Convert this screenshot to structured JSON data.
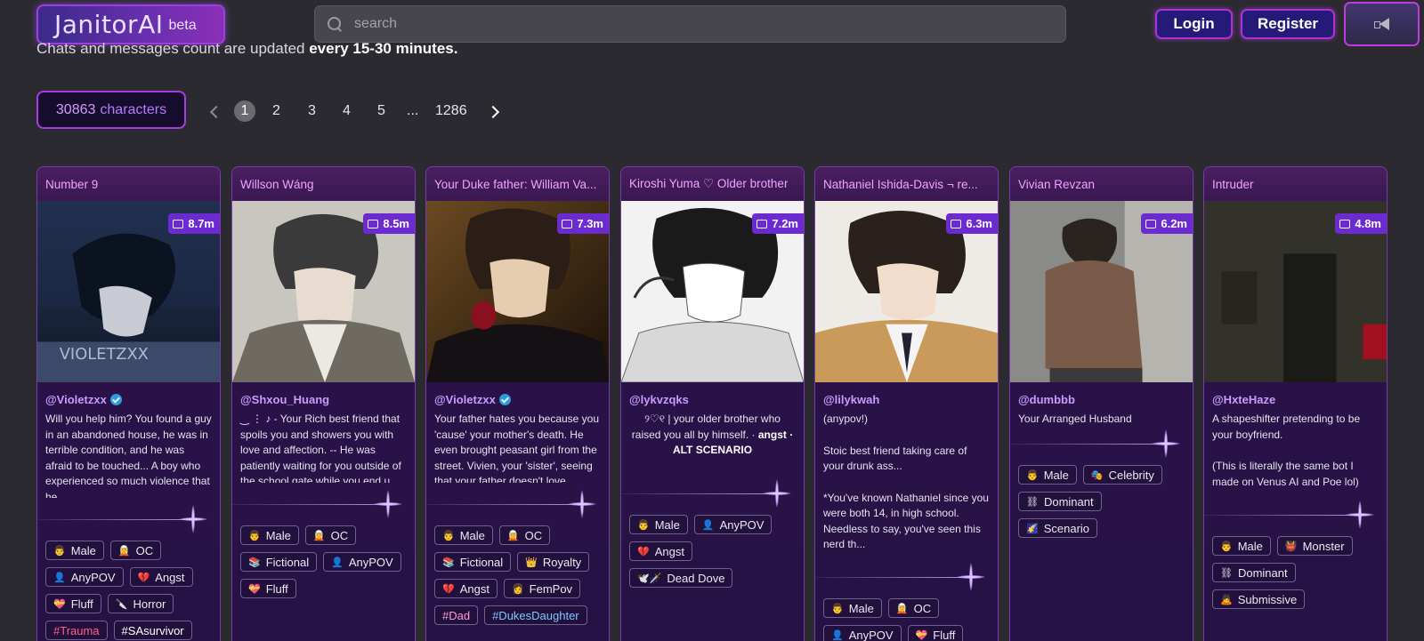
{
  "header": {
    "logo": "JanitorAI",
    "logo_badge": "beta",
    "search_placeholder": "search",
    "login_label": "Login",
    "register_label": "Register"
  },
  "notice": {
    "prefix": "Chats and messages count are updated",
    "bold": "every 15-30 minutes."
  },
  "count": {
    "number": "30863",
    "label": "characters"
  },
  "pagination": {
    "pages": [
      "1",
      "2",
      "3",
      "4",
      "5",
      "...",
      "1286"
    ],
    "current": "1"
  },
  "cards": [
    {
      "title": "Number 9",
      "chats": "8.7m",
      "creator": "@Violetzxx",
      "verified": true,
      "description": "Will you help him? You found a guy in an abandoned house, he was in terrible condition, and he was afraid to be touched... A boy who experienced so much violence that he...",
      "tags": [
        {
          "icon": "👨",
          "label": "Male"
        },
        {
          "icon": "🧝",
          "label": "OC"
        },
        {
          "icon": "👤",
          "label": "AnyPOV"
        },
        {
          "icon": "💔",
          "label": "Angst"
        },
        {
          "icon": "💝",
          "label": "Fluff"
        },
        {
          "icon": "🔪",
          "label": "Horror"
        },
        {
          "icon": "",
          "label": "#Trauma",
          "style": "red"
        },
        {
          "icon": "",
          "label": "#SAsurvivor",
          "style": "white"
        }
      ]
    },
    {
      "title": "Willson Wáng",
      "chats": "8.5m",
      "creator": "@Shxou_Huang",
      "verified": false,
      "description": "‿ ⋮ ♪ - Your Rich best friend that spoils you and showers you with love and affection. -- He was patiently waiting for you outside of the school gate while you end u...",
      "tags": [
        {
          "icon": "👨",
          "label": "Male"
        },
        {
          "icon": "🧝",
          "label": "OC"
        },
        {
          "icon": "📚",
          "label": "Fictional"
        },
        {
          "icon": "👤",
          "label": "AnyPOV"
        },
        {
          "icon": "💝",
          "label": "Fluff"
        }
      ]
    },
    {
      "title": "Your Duke father: William Va...",
      "chats": "7.3m",
      "creator": "@Violetzxx",
      "verified": true,
      "description": "Your father hates you because you 'cause' your mother's death. He even brought peasant girl from the street. Vivien, your 'sister', seeing that your father doesn't love ...",
      "tags": [
        {
          "icon": "👨",
          "label": "Male"
        },
        {
          "icon": "🧝",
          "label": "OC"
        },
        {
          "icon": "📚",
          "label": "Fictional"
        },
        {
          "icon": "👑",
          "label": "Royalty"
        },
        {
          "icon": "💔",
          "label": "Angst"
        },
        {
          "icon": "👩",
          "label": "FemPov"
        },
        {
          "icon": "",
          "label": "#Dad",
          "style": "pink"
        },
        {
          "icon": "",
          "label": "#DukesDaughter",
          "style": "blue"
        }
      ]
    },
    {
      "title": "Kiroshi Yuma ♡ Older brother",
      "chats": "7.2m",
      "creator": "@lykvzqks",
      "verified": false,
      "description": "୨♡୧ | your older brother who raised you all by himself. ·",
      "description_bold": "angst · ALT SCENARIO",
      "centered": true,
      "tags": [
        {
          "icon": "👨",
          "label": "Male"
        },
        {
          "icon": "👤",
          "label": "AnyPOV"
        },
        {
          "icon": "💔",
          "label": "Angst"
        },
        {
          "icon": "🕊️🗡️",
          "label": "Dead Dove"
        }
      ]
    },
    {
      "title": "Nathaniel Ishida-Davis ¬ re...",
      "chats": "6.3m",
      "creator": "@lilykwah",
      "verified": false,
      "description_lines": [
        "(anypov!)",
        "",
        "Stoic best friend taking care of your drunk ass...",
        "",
        "*You've known Nathaniel since you were both 14, in high school. Needless to say, you've seen this nerd th..."
      ],
      "tags": [
        {
          "icon": "👨",
          "label": "Male"
        },
        {
          "icon": "🧝",
          "label": "OC"
        },
        {
          "icon": "👤",
          "label": "AnyPOV"
        },
        {
          "icon": "💝",
          "label": "Fluff"
        }
      ]
    },
    {
      "title": "Vivian Revzan",
      "chats": "6.2m",
      "creator": "@dumbbb",
      "verified": false,
      "description": "Your Arranged Husband",
      "tags": [
        {
          "icon": "👨",
          "label": "Male"
        },
        {
          "icon": "🎭",
          "label": "Celebrity"
        },
        {
          "icon": "⛓",
          "label": "Dominant"
        },
        {
          "icon": "🌠",
          "label": "Scenario"
        }
      ]
    },
    {
      "title": "Intruder",
      "chats": "4.8m",
      "creator": "@HxteHaze",
      "verified": false,
      "description_lines": [
        "A shapeshifter pretending to be your boyfriend.",
        "",
        "(This is literally the same bot I made on Venus AI and Poe lol)"
      ],
      "tags": [
        {
          "icon": "👨",
          "label": "Male"
        },
        {
          "icon": "👹",
          "label": "Monster"
        },
        {
          "icon": "⛓",
          "label": "Dominant"
        },
        {
          "icon": "🙇",
          "label": "Submissive"
        }
      ]
    }
  ]
}
